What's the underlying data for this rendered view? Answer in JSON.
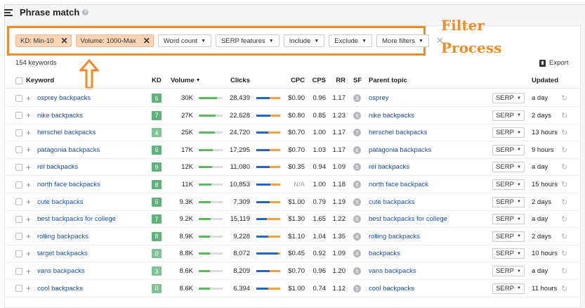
{
  "page": {
    "title": "Phrase match",
    "keyword_count": "154 keywords",
    "export_label": "Export"
  },
  "filters": {
    "active": [
      {
        "label": "KD: Min-10"
      },
      {
        "label": "Volume: 1000-Max"
      }
    ],
    "dropdowns": [
      {
        "label": "Word count"
      },
      {
        "label": "SERP features"
      },
      {
        "label": "Include"
      },
      {
        "label": "Exclude"
      },
      {
        "label": "More filters"
      }
    ]
  },
  "annotation": {
    "line1": "Filter",
    "line2": "Process"
  },
  "colors": {
    "accent": "#f28a26",
    "kd_green": "#5fb37a",
    "kd_lightgreen": "#82c196",
    "link": "#1c4c9c"
  },
  "table": {
    "headers": {
      "keyword": "Keyword",
      "kd": "KD",
      "volume": "Volume",
      "clicks": "Clicks",
      "cpc": "CPC",
      "cps": "CPS",
      "rr": "RR",
      "sf": "SF",
      "parent_topic": "Parent topic",
      "updated": "Updated"
    },
    "rows": [
      {
        "keyword": "osprey backpacks",
        "kd": "6",
        "kd_color": "#5fb37a",
        "volume": "30K",
        "volume_level": 0.75,
        "clicks": "28,439",
        "clicks_paid_fraction": 0.55,
        "cpc": "$0.90",
        "cpc_muted": false,
        "cps": "0.96",
        "rr": "1.17",
        "sf": "3",
        "parent_topic": "osprey",
        "serp": "SERP",
        "updated": "a day"
      },
      {
        "keyword": "nike backpacks",
        "kd": "7",
        "kd_color": "#5fb37a",
        "volume": "27K",
        "volume_level": 0.7,
        "clicks": "22,628",
        "clicks_paid_fraction": 0.6,
        "cpc": "$0.80",
        "cpc_muted": false,
        "cps": "0.85",
        "rr": "1.23",
        "sf": "5",
        "parent_topic": "nike backpacks",
        "serp": "SERP",
        "updated": "2 days"
      },
      {
        "keyword": "herschel backpacks",
        "kd": "4",
        "kd_color": "#82c196",
        "volume": "25K",
        "volume_level": 0.68,
        "clicks": "24,720",
        "clicks_paid_fraction": 0.5,
        "cpc": "$0.70",
        "cpc_muted": false,
        "cps": "1.00",
        "rr": "1.17",
        "sf": "7",
        "parent_topic": "herschel backpacks",
        "serp": "SERP",
        "updated": "13 hours"
      },
      {
        "keyword": "patagonia backpacks",
        "kd": "6",
        "kd_color": "#5fb37a",
        "volume": "17K",
        "volume_level": 0.6,
        "clicks": "17,295",
        "clicks_paid_fraction": 0.55,
        "cpc": "$0.70",
        "cpc_muted": false,
        "cps": "1.03",
        "rr": "1.17",
        "sf": "6",
        "parent_topic": "patagonia backpacks",
        "serp": "SERP",
        "updated": "9 hours"
      },
      {
        "keyword": "rei backpacks",
        "kd": "9",
        "kd_color": "#5fb37a",
        "volume": "12K",
        "volume_level": 0.55,
        "clicks": "11,080",
        "clicks_paid_fraction": 0.55,
        "cpc": "$0.35",
        "cpc_muted": false,
        "cps": "0.94",
        "rr": "1.09",
        "sf": "5",
        "parent_topic": "rei backpacks",
        "serp": "SERP",
        "updated": "a day"
      },
      {
        "keyword": "north face backpacks",
        "kd": "8",
        "kd_color": "#5fb37a",
        "volume": "11K",
        "volume_level": 0.52,
        "clicks": "10,853",
        "clicks_paid_fraction": 0.6,
        "cpc": "N/A",
        "cpc_muted": true,
        "cps": "1.00",
        "rr": "1.18",
        "sf": "6",
        "parent_topic": "north face backpack",
        "serp": "SERP",
        "updated": "15 hours"
      },
      {
        "keyword": "cute backpacks",
        "kd": "6",
        "kd_color": "#5fb37a",
        "volume": "9.3K",
        "volume_level": 0.5,
        "clicks": "7,309",
        "clicks_paid_fraction": 0.55,
        "cpc": "$1.00",
        "cpc_muted": false,
        "cps": "0.79",
        "rr": "1.19",
        "sf": "5",
        "parent_topic": "cute backpacks",
        "serp": "SERP",
        "updated": "2 days"
      },
      {
        "keyword": "best backpacks for college",
        "kd": "7",
        "kd_color": "#5fb37a",
        "volume": "9.2K",
        "volume_level": 0.5,
        "clicks": "15,119",
        "clicks_paid_fraction": 0.45,
        "cpc": "$1.30",
        "cpc_muted": false,
        "cps": "1.65",
        "rr": "1.22",
        "sf": "6",
        "parent_topic": "best backpacks for college",
        "serp": "SERP",
        "updated": "a day"
      },
      {
        "keyword": "rolling backpacks",
        "kd": "8",
        "kd_color": "#5fb37a",
        "volume": "8.9K",
        "volume_level": 0.48,
        "clicks": "9,228",
        "clicks_paid_fraction": 0.5,
        "cpc": "$1.10",
        "cpc_muted": false,
        "cps": "1.04",
        "rr": "1.35",
        "sf": "4",
        "parent_topic": "rolling backpacks",
        "serp": "SERP",
        "updated": "2 days"
      },
      {
        "keyword": "target backpacks",
        "kd": "0",
        "kd_color": "#82c196",
        "volume": "8.8K",
        "volume_level": 0.47,
        "clicks": "8,072",
        "clicks_paid_fraction": 0.9,
        "cpc": "$0.45",
        "cpc_muted": false,
        "cps": "0.92",
        "rr": "1.09",
        "sf": "4",
        "parent_topic": "backpacks",
        "serp": "SERP",
        "updated": "10 hours"
      },
      {
        "keyword": "vans backpacks",
        "kd": "3",
        "kd_color": "#82c196",
        "volume": "8.6K",
        "volume_level": 0.47,
        "clicks": "8,209",
        "clicks_paid_fraction": 0.55,
        "cpc": "$0.70",
        "cpc_muted": false,
        "cps": "0.96",
        "rr": "1.20",
        "sf": "5",
        "parent_topic": "vans backpacks",
        "serp": "SERP",
        "updated": "a day"
      },
      {
        "keyword": "cool backpacks",
        "kd": "0",
        "kd_color": "#82c196",
        "volume": "8.6K",
        "volume_level": 0.46,
        "clicks": "6,394",
        "clicks_paid_fraction": 0.5,
        "cpc": "$1.00",
        "cpc_muted": false,
        "cps": "0.74",
        "rr": "1.12",
        "sf": "5",
        "parent_topic": "cool backpacks",
        "serp": "SERP",
        "updated": "11 hours"
      }
    ]
  }
}
